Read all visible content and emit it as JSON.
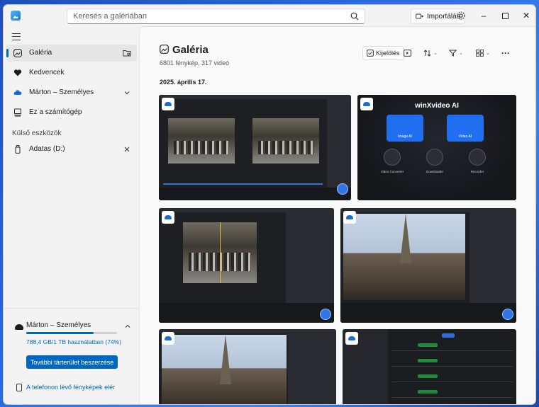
{
  "window": {
    "search_placeholder": "Keresés a galériában",
    "import_label": "Importálás"
  },
  "sidebar": {
    "items": [
      {
        "label": "Galéria",
        "icon": "gallery-icon"
      },
      {
        "label": "Kedvencek",
        "icon": "heart-icon"
      },
      {
        "label": "Márton – Személyes",
        "icon": "cloud-icon"
      },
      {
        "label": "Ez a számítógép",
        "icon": "computer-icon"
      }
    ],
    "external_section": "Külső eszközök",
    "external_items": [
      {
        "label": "Adatas (D:)",
        "icon": "usb-drive-icon"
      }
    ]
  },
  "storage": {
    "account": "Márton – Személyes",
    "usage_text": "788,4 GB/1 TB használatban (74%)",
    "usage_fraction": 0.74,
    "buy_label": "További tárterület beszerzése",
    "phone_link": "A telefonon lévő fényképek elér"
  },
  "main": {
    "title": "Galéria",
    "subtitle": "6801 fénykép, 317 videó",
    "select_label": "Kijelölés",
    "date_header": "2025. április 17."
  },
  "thumbs": {
    "winx_logo": "winXvideo AI",
    "winx_cards": [
      "Image AI",
      "Video AI"
    ],
    "winx_tools": [
      "Video Converter",
      "Downloader",
      "Recorder"
    ]
  },
  "colors": {
    "accent": "#0067c0",
    "cloud_blue": "#1b6bd3"
  }
}
